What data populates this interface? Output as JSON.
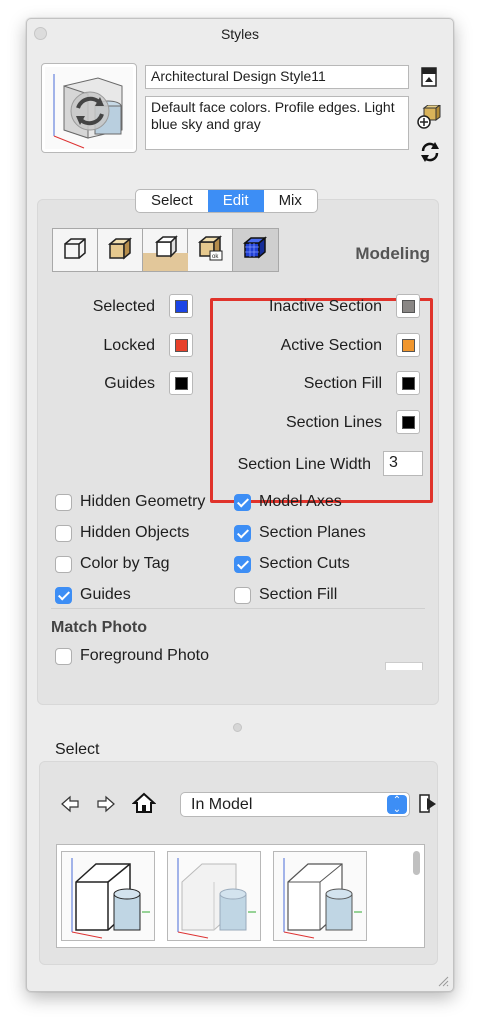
{
  "window": {
    "title": "Styles"
  },
  "style": {
    "name": "Architectural Design Style11",
    "description": "Default face colors. Profile edges. Light blue sky and gray"
  },
  "tabs": [
    {
      "label": "Select",
      "active": false
    },
    {
      "label": "Edit",
      "active": true
    },
    {
      "label": "Mix",
      "active": false
    }
  ],
  "edit": {
    "mode_title": "Modeling",
    "mode_icons": [
      "edge-settings-icon",
      "face-settings-icon",
      "background-settings-icon",
      "watermark-settings-icon",
      "modeling-settings-icon"
    ],
    "left_colors": [
      {
        "label": "Selected",
        "color": "#1a44e6"
      },
      {
        "label": "Locked",
        "color": "#e8402a"
      },
      {
        "label": "Guides",
        "color": "#000000"
      }
    ],
    "right_colors": [
      {
        "label": "Inactive Section",
        "color": "#8a8785"
      },
      {
        "label": "Active Section",
        "color": "#f0962d"
      },
      {
        "label": "Section Fill",
        "color": "#000000"
      },
      {
        "label": "Section Lines",
        "color": "#000000"
      }
    ],
    "section_line_width": {
      "label": "Section Line Width",
      "value": "3"
    },
    "checkboxes_left": [
      {
        "label": "Hidden Geometry",
        "checked": false
      },
      {
        "label": "Hidden Objects",
        "checked": false
      },
      {
        "label": "Color by Tag",
        "checked": false
      },
      {
        "label": "Guides",
        "checked": true
      }
    ],
    "checkboxes_right": [
      {
        "label": "Model Axes",
        "checked": true
      },
      {
        "label": "Section Planes",
        "checked": true
      },
      {
        "label": "Section Cuts",
        "checked": true
      },
      {
        "label": "Section Fill",
        "checked": false
      }
    ],
    "match_photo": {
      "title": "Match Photo",
      "foreground_photo": {
        "label": "Foreground Photo",
        "checked": false
      }
    }
  },
  "library": {
    "label": "Select",
    "dropdown_value": "In Model",
    "thumbnails": 3
  },
  "colors": {
    "accent": "#3d8ef5",
    "highlight": "#e0332b"
  }
}
